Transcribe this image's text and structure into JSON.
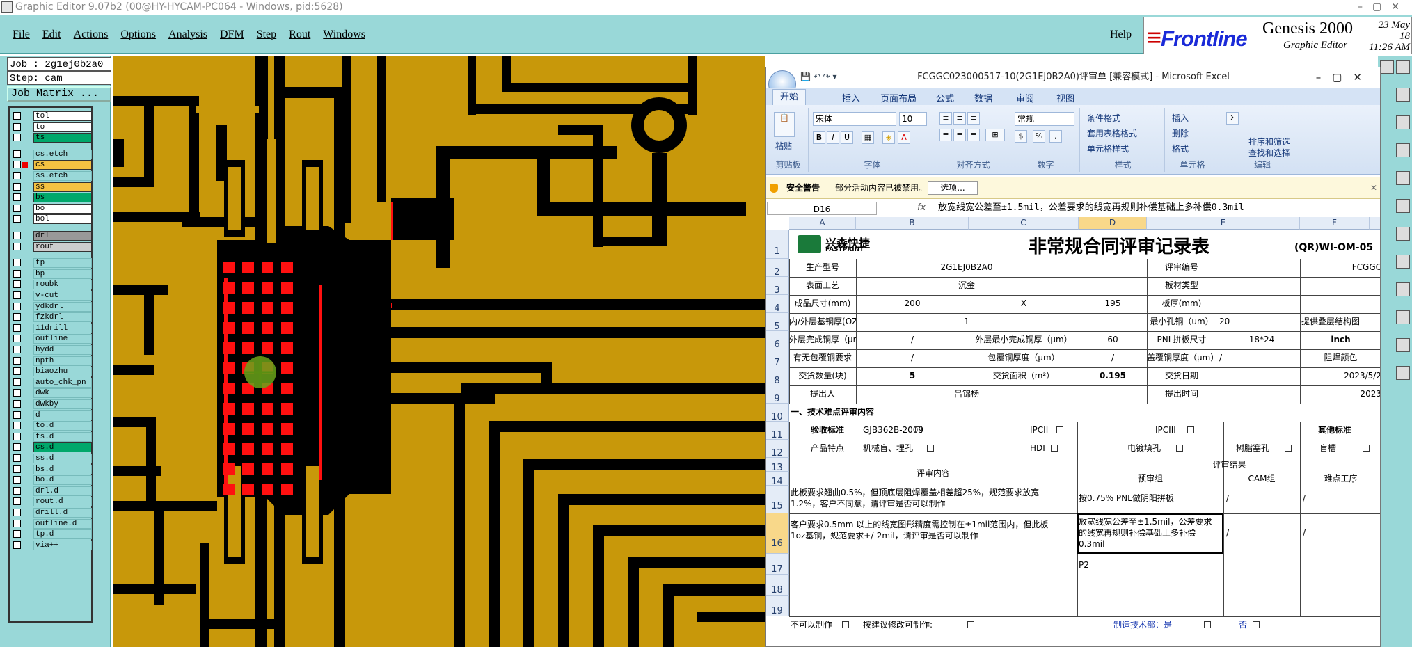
{
  "window_title": "Graphic Editor 9.07b2 (00@HY-HYCAM-PC064 - Windows, pid:5628)",
  "menu": [
    "File",
    "Edit",
    "Actions",
    "Options",
    "Analysis",
    "DFM",
    "Step",
    "Rout",
    "Windows"
  ],
  "help": "Help",
  "brand": {
    "logo": "Frontline",
    "product": "Genesis 2000",
    "sub": "Graphic Editor",
    "date": "23 May 18",
    "time": "11:26 AM"
  },
  "job": {
    "job": "Job : 2g1ej0b2a0",
    "step": "Step: cam",
    "matrix_button": "Job Matrix ..."
  },
  "layers": [
    {
      "n": "tol",
      "c": "#ffffff"
    },
    {
      "n": "to",
      "c": "#ffffff"
    },
    {
      "n": "ts",
      "c": "#00a86b"
    },
    {
      "n": "cs.etch",
      "c": "#99d8d8"
    },
    {
      "n": "cs",
      "c": "#f5c242",
      "sel": true
    },
    {
      "n": "ss.etch",
      "c": "#99d8d8"
    },
    {
      "n": "ss",
      "c": "#f5c242"
    },
    {
      "n": "bs",
      "c": "#00a86b"
    },
    {
      "n": "bo",
      "c": "#ffffff"
    },
    {
      "n": "bol",
      "c": "#ffffff"
    },
    {
      "n": "drl",
      "c": "#999999"
    },
    {
      "n": "rout",
      "c": "#cccccc"
    },
    {
      "n": "tp",
      "c": "#99d8d8"
    },
    {
      "n": "bp",
      "c": "#99d8d8"
    },
    {
      "n": "roubk",
      "c": "#99d8d8"
    },
    {
      "n": "v-cut",
      "c": "#99d8d8"
    },
    {
      "n": "ydkdrl",
      "c": "#99d8d8"
    },
    {
      "n": "fzkdrl",
      "c": "#99d8d8"
    },
    {
      "n": "11drill",
      "c": "#99d8d8"
    },
    {
      "n": "outline",
      "c": "#99d8d8"
    },
    {
      "n": "hydd",
      "c": "#99d8d8"
    },
    {
      "n": "npth",
      "c": "#99d8d8"
    },
    {
      "n": "biaozhu",
      "c": "#99d8d8"
    },
    {
      "n": "auto_chk_pn",
      "c": "#99d8d8"
    },
    {
      "n": "dwk",
      "c": "#99d8d8"
    },
    {
      "n": "dwkby",
      "c": "#99d8d8"
    },
    {
      "n": "d",
      "c": "#99d8d8"
    },
    {
      "n": "to.d",
      "c": "#99d8d8"
    },
    {
      "n": "ts.d",
      "c": "#99d8d8"
    },
    {
      "n": "cs.d",
      "c": "#00a86b"
    },
    {
      "n": "ss.d",
      "c": "#99d8d8"
    },
    {
      "n": "bs.d",
      "c": "#99d8d8"
    },
    {
      "n": "bo.d",
      "c": "#99d8d8"
    },
    {
      "n": "drl.d",
      "c": "#99d8d8"
    },
    {
      "n": "rout.d",
      "c": "#99d8d8"
    },
    {
      "n": "drill.d",
      "c": "#99d8d8"
    },
    {
      "n": "outline.d",
      "c": "#99d8d8"
    },
    {
      "n": "tp.d",
      "c": "#99d8d8"
    },
    {
      "n": "via++",
      "c": "#99d8d8"
    }
  ],
  "excel": {
    "title": "FCGGC023000517-10(2G1EJ0B2A0)评审单  [兼容模式] - Microsoft Excel",
    "tabs": [
      "开始",
      "插入",
      "页面布局",
      "公式",
      "数据",
      "审阅",
      "视图"
    ],
    "ribbon": {
      "clipboard": "剪贴板",
      "paste": "粘贴",
      "font_name": "宋体",
      "font_size": "10",
      "font": "字体",
      "align": "对齐方式",
      "num_format": "常规",
      "number": "数字",
      "style": "样式",
      "cond": "条件格式",
      "table": "套用表格格式",
      "cellstyle": "单元格样式",
      "cells": "单元格",
      "insert": "插入",
      "delete": "删除",
      "format": "格式",
      "edit": "编辑",
      "sort": "排序和筛选",
      "find": "查找和选择"
    },
    "security": {
      "label": "安全警告",
      "msg": "部分活动内容已被禁用。",
      "btn": "选项..."
    },
    "namebox": "D16",
    "formula": "放宽线宽公差至±1.5mil，公差要求的线宽再规则补偿基础上多补偿0.3mil",
    "cols": [
      "A",
      "B",
      "C",
      "D",
      "E",
      "F",
      "G"
    ],
    "rows": [
      "1",
      "2",
      "3",
      "4",
      "5",
      "6",
      "7",
      "8",
      "9",
      "10",
      "11",
      "12",
      "13",
      "14",
      "15",
      "16",
      "17",
      "18",
      "19"
    ],
    "logo_cn": "兴森快捷",
    "logo_en": "FASTPRINT",
    "sheet_title": "非常规合同评审记录表",
    "form_no": "(QR)WI-OM-05",
    "r2": [
      "生产型号",
      "2G1EJ0B2A0",
      "评审编号",
      "FCGGC"
    ],
    "r3": [
      "表面工艺",
      "沉金",
      "板材类型"
    ],
    "r4": [
      "成品尺寸(mm)",
      "200",
      "X",
      "195",
      "板厚(mm)"
    ],
    "r5": [
      "内/外层基铜厚(OZ)",
      "1",
      "最小孔铜（um）",
      "20",
      "提供叠层结构图"
    ],
    "r6": [
      "外层完成铜厚（μm）",
      "/",
      "外层最小完成铜厚（μm）",
      "60",
      "PNL拼板尺寸",
      "18*24",
      "inch"
    ],
    "r7": [
      "有无包覆铜要求",
      "/",
      "包覆铜厚度（μm）",
      "/",
      "盖覆铜厚度（μm）",
      "/",
      "阻焊颜色"
    ],
    "r8": [
      "交货数量(块)",
      "5",
      "交货面积（m²）",
      "0.195",
      "交货日期",
      "2023/5/2"
    ],
    "r9": [
      "提出人",
      "吕锦杨",
      "提出时间",
      "2023"
    ],
    "r10": "一、技术难点评审内容",
    "r11": [
      "验收标准",
      "GJB362B-2009",
      "IPCII",
      "IPCIII",
      "其他标准"
    ],
    "r12": [
      "产品特点",
      "机械盲、埋孔",
      "HDI",
      "电镀填孔",
      "树脂塞孔",
      "盲槽"
    ],
    "r13": [
      "评审内容",
      "评审结果"
    ],
    "r14": [
      "预审组",
      "CAM组",
      "难点工序"
    ],
    "r15": [
      "此板要求翘曲0.5%，但顶底层阻焊覆盖相差超25%，规范要求放宽",
      "1.2%，客户不同意，请评审是否可以制作",
      "按0.75% PNL做阴阳拼板",
      "/",
      "/"
    ],
    "r16": [
      "客户要求0.5mm 以上的线宽图形精度需控制在±1mil范围内，但此板",
      "1oz基铜，规范要求+/-2mil，请评审是否可以制作",
      "放宽线宽公差至±1.5mil，公差要求",
      "的线宽再规则补偿基础上多补偿",
      "0.3mil",
      "/",
      "/"
    ],
    "r17": "P2",
    "r20": [
      "不可以制作",
      "按建议修改可制作:",
      "制造技术部：是",
      "否"
    ]
  }
}
